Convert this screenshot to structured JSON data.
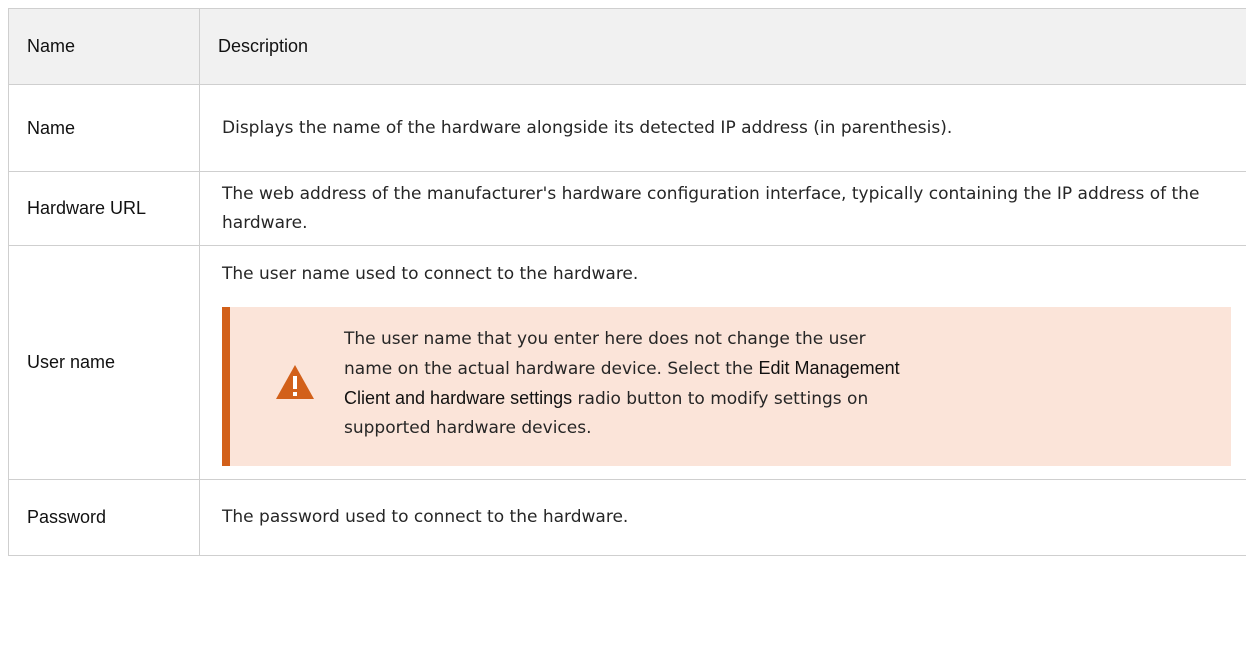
{
  "table": {
    "headers": {
      "name": "Name",
      "description": "Description"
    },
    "rows": [
      {
        "name": "Name",
        "description": "Displays the name of the hardware alongside its detected IP address (in parenthesis)."
      },
      {
        "name": "Hardware URL",
        "description": "The web address of the manufacturer's hardware configuration interface, typically containing the IP address of the hardware."
      },
      {
        "name": "User name",
        "description": "The user name used to connect to the hardware.",
        "warning": {
          "icon": "warning-triangle-icon",
          "text_before": "The user name that you enter here does not change the user name on the actual hardware device. Select the ",
          "emphasis": "Edit Management Client and hardware settings",
          "text_after": " radio button to modify settings on supported hardware devices."
        }
      },
      {
        "name": "Password",
        "description": "The password used to connect to the hardware."
      }
    ]
  },
  "colors": {
    "header_background": "#f1f1f1",
    "border": "#cfcfcf",
    "warning_background": "#fbe4d9",
    "warning_accent": "#d2601a"
  }
}
